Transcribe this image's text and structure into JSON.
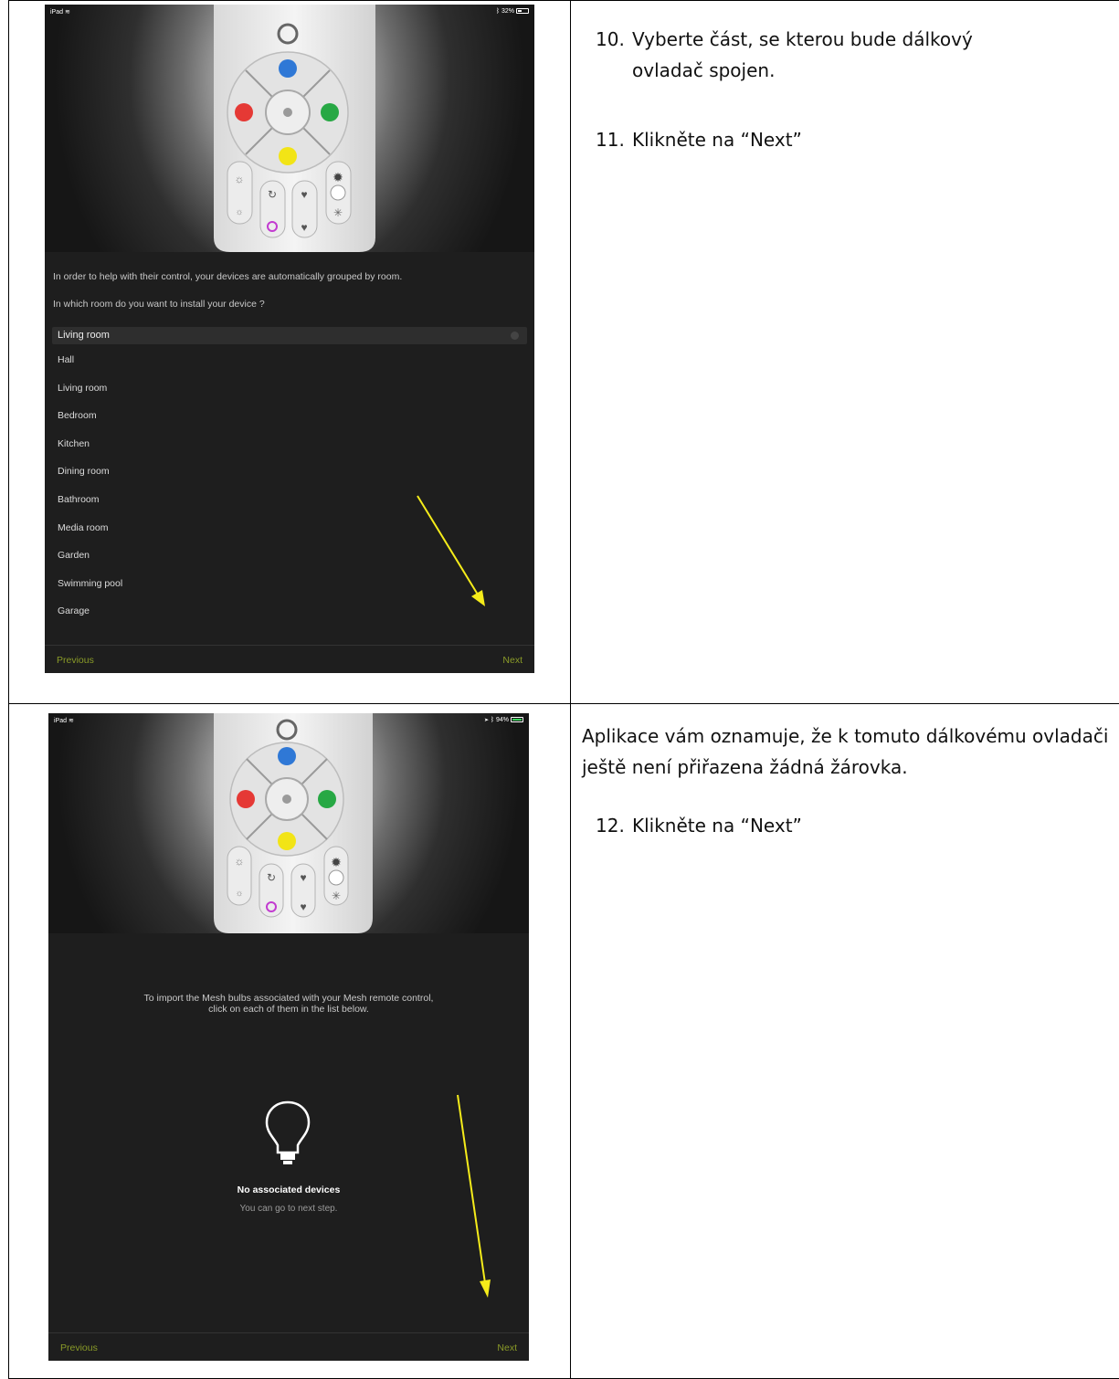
{
  "panel1": {
    "status": {
      "device": "iPad",
      "battery": "32%"
    },
    "intro_line1": "In order to help with their control, your devices are automatically grouped by room.",
    "intro_line2": "In which room do you want to install your device ?",
    "selected_room": "Living room",
    "rooms": [
      "Hall",
      "Living room",
      "Bedroom",
      "Kitchen",
      "Dining room",
      "Bathroom",
      "Media room",
      "Garden",
      "Swimming pool",
      "Garage"
    ],
    "previous_label": "Previous",
    "next_label": "Next"
  },
  "panel2": {
    "status": {
      "device": "iPad",
      "battery": "94%"
    },
    "message_line1": "To import the Mesh bulbs associated with your Mesh remote control,",
    "message_line2": "click on each of them in the list below.",
    "no_devices": "No associated devices",
    "go_next": "You can go to next step.",
    "previous_label": "Previous",
    "next_label": "Next"
  },
  "instructions": {
    "step10_num": "10.",
    "step10_text": "Vyberte část, se kterou bude dálkový ovladač spojen.",
    "step11_num": "11.",
    "step11_text": "Klikněte na “Next”",
    "note": "Aplikace vám oznamuje, že k tomuto dálkovému ovladači ještě není přiřazena žádná žárovka.",
    "step12_num": "12.",
    "step12_text": "Klikněte na “Next”"
  },
  "icons": [
    "wifi-icon",
    "bluetooth-icon",
    "battery-icon",
    "remote-control-image",
    "bulb-icon",
    "arrow-annotation"
  ],
  "colors": {
    "accent": "#8a9b28",
    "panel_bg": "#1e1e1e",
    "arrow": "#f5ec1a"
  }
}
